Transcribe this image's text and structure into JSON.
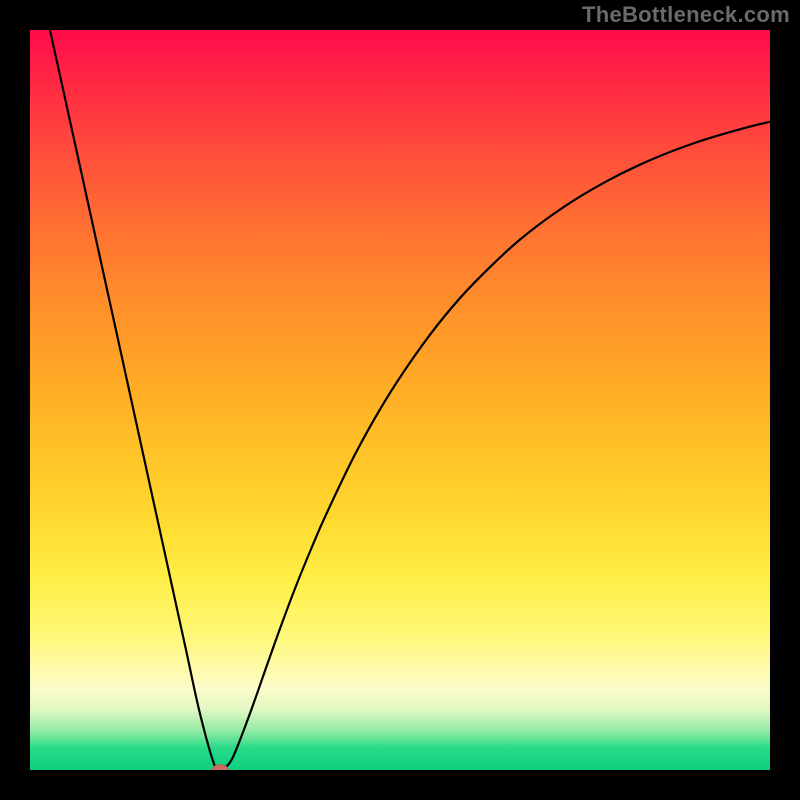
{
  "watermark": "TheBottleneck.com",
  "chart_data": {
    "type": "line",
    "title": "",
    "xlabel": "",
    "ylabel": "",
    "xlim": [
      0,
      100
    ],
    "ylim": [
      0,
      100
    ],
    "grid": false,
    "legend": false,
    "series": [
      {
        "name": "bottleneck-curve",
        "x": [
          2.7,
          4,
          6,
          8,
          10,
          12,
          15,
          18,
          21,
          23,
          25,
          26,
          27,
          28,
          30,
          32,
          34,
          36,
          38,
          40,
          44,
          48,
          52,
          56,
          60,
          66,
          72,
          78,
          84,
          90,
          96,
          100
        ],
        "values": [
          100,
          94.1,
          85.0,
          75.9,
          66.8,
          57.7,
          44.0,
          30.3,
          16.6,
          7.5,
          0.5,
          0.2,
          1.0,
          3.1,
          8.4,
          14.1,
          19.7,
          25.0,
          29.9,
          34.5,
          42.8,
          49.9,
          56.0,
          61.3,
          65.8,
          71.5,
          76.0,
          79.6,
          82.5,
          84.8,
          86.6,
          87.6
        ]
      }
    ],
    "marker": {
      "x": 25.7,
      "y": 0.1,
      "rx": 1.1,
      "ry": 0.65
    },
    "background": {
      "type": "vertical-gradient",
      "stops": [
        {
          "pos": 0.0,
          "color": "#ff0b4b"
        },
        {
          "pos": 0.16,
          "color": "#ff4b3c"
        },
        {
          "pos": 0.36,
          "color": "#ff8c2b"
        },
        {
          "pos": 0.56,
          "color": "#ffc027"
        },
        {
          "pos": 0.74,
          "color": "#ffee46"
        },
        {
          "pos": 0.89,
          "color": "#fdfcca"
        },
        {
          "pos": 0.95,
          "color": "#88e9a0"
        },
        {
          "pos": 1.0,
          "color": "#0dd07f"
        }
      ]
    }
  }
}
